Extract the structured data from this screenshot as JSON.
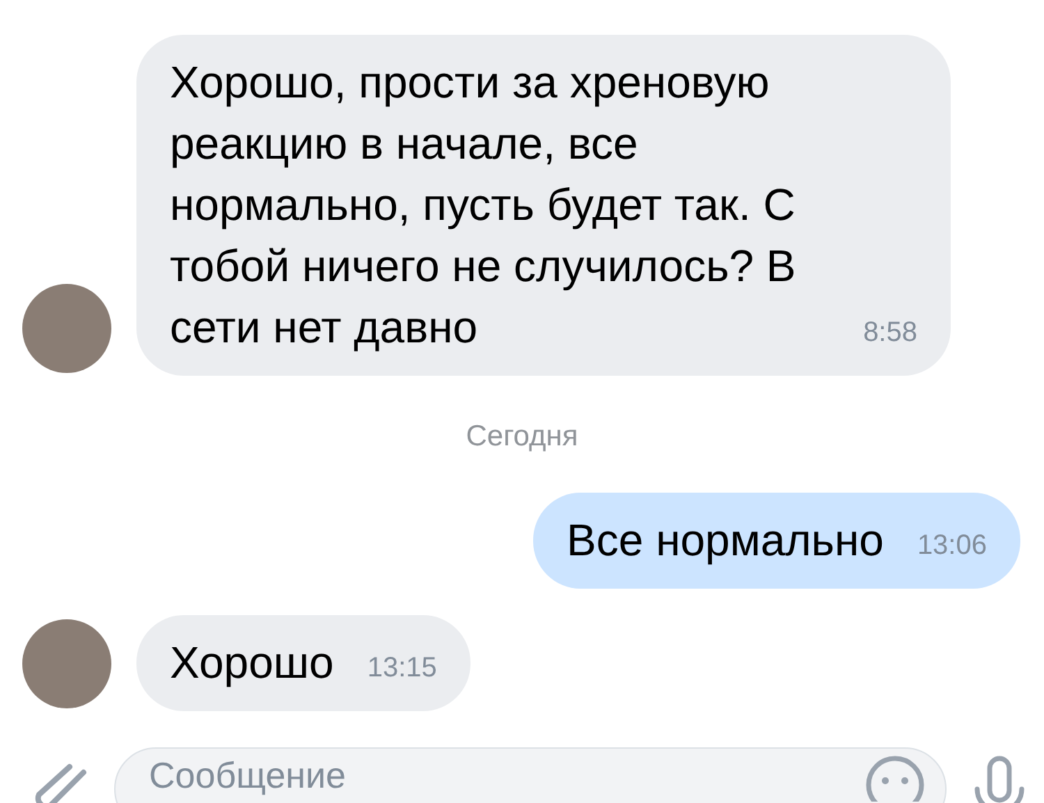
{
  "messages": [
    {
      "kind": "incoming",
      "text": "Хорошо, прости за хреновую реакцию в начале, все нормально, пусть будет так. С тобой ничего не случилось? В сети нет давно",
      "time": "8:58"
    },
    {
      "kind": "date",
      "text": "Сегодня"
    },
    {
      "kind": "outgoing",
      "text": "Все нормально",
      "time": "13:06"
    },
    {
      "kind": "incoming",
      "text": "Хорошо",
      "time": "13:15"
    }
  ],
  "composer": {
    "placeholder": "Сообщение"
  }
}
